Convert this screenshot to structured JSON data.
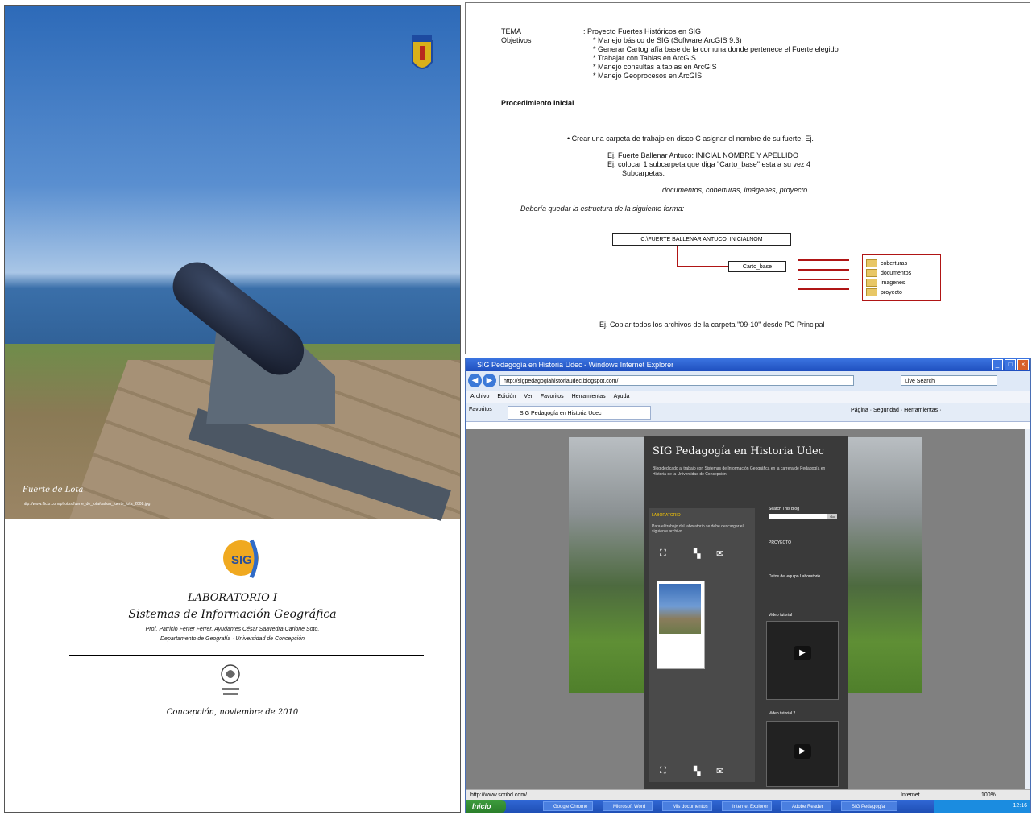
{
  "cover": {
    "photo_caption": "Fuerte de Lota",
    "photo_url": "http://www.flickr.com/photos/fuerte_de_lota/cañon_fuerte_lota_2008.jpg",
    "lab_title": "LABORATORIO I",
    "course_title": "Sistemas de Información Geográfica",
    "professors": "Prof. Patricio Ferrer Ferrer. Ayudantes César Saavedra Carlone Soto.",
    "department": "Departamento de Geografía · Universidad de Concepción",
    "place_date": "Concepción, noviembre de 2010",
    "sig_logo": "SIG"
  },
  "doc": {
    "tema_label": "TEMA",
    "tema_value": ": Proyecto Fuertes Históricos en SIG",
    "objetivos_label": "Objetivos",
    "objectives": [
      "* Manejo básico de SIG (Software ArcGIS 9.3)",
      "* Generar Cartografía base de la comuna donde pertenece el Fuerte elegido",
      "* Trabajar con Tablas en ArcGIS",
      "* Manejo consultas a tablas en ArcGIS",
      "* Manejo Geoprocesos en ArcGIS"
    ],
    "procedure_heading": "Procedimiento Inicial",
    "step1": "• Crear una carpeta de trabajo en disco C asignar el nombre de su fuerte. Ej.",
    "example1": "Ej. Fuerte Ballenar Antuco: INICIAL NOMBRE Y APELLIDO",
    "example2": "Ej. colocar 1 subcarpeta que diga \"Carto_base\" esta a su vez 4",
    "example3": "Subcarpetas:",
    "subfolders_line": "documentos, coberturas, imágenes, proyecto",
    "structure_note": "Debería quedar la estructura de la siguiente forma:",
    "root_folder": "C:\\FUERTE BALLENAR ANTUCO_INICIALNOM",
    "base_folder": "Carto_base",
    "folders": [
      "coberturas",
      "documentos",
      "imagenes",
      "proyecto"
    ],
    "step_copy": "Ej. Copiar todos los archivos de la carpeta \"09-10\" desde PC Principal"
  },
  "browser": {
    "window_title": "SIG Pedagogía en Historia Udec - Windows Internet Explorer",
    "address": "http://sigpedagogiahistoriaudec.blogspot.com/",
    "search_placeholder": "Live Search",
    "menu": [
      "Archivo",
      "Edición",
      "Ver",
      "Favoritos",
      "Herramientas",
      "Ayuda"
    ],
    "favorites_label": "Favoritos",
    "tab_label": "SIG Pedagogía en Historia Udec",
    "command_bar": "Página · Seguridad · Herramientas ·",
    "blog_title": "SIG Pedagogía en Historia Udec",
    "blog_description": "Blog dedicado al trabajo con Sistemas de Información Geográfica en la carrera de Pedagogía en Historia de la Universidad de Concepción",
    "gadget1_head": "LABORATORIO",
    "gadget1_text": "Para el trabajo del laboratorio se debe descargar el siguiente archivo.",
    "search_title": "Search This Blog",
    "search_button": "Go",
    "gadget2_head": "PROYECTO",
    "gadget3_head": "Datos del equipo Laboratorio",
    "gadget4_head": "Video tutorial",
    "gadget5_head": "Video tutorial 2",
    "status_text": "http://www.scribd.com/",
    "status_zone": "Internet",
    "zoom": "100%",
    "taskbar_start": "Inicio",
    "taskbar_items": [
      "Google Chrome",
      "Microsoft Word",
      "Mis documentos",
      "Internet Explorer",
      "Adobe Reader",
      "SIG Pedagogía"
    ],
    "clock": "12:16"
  }
}
